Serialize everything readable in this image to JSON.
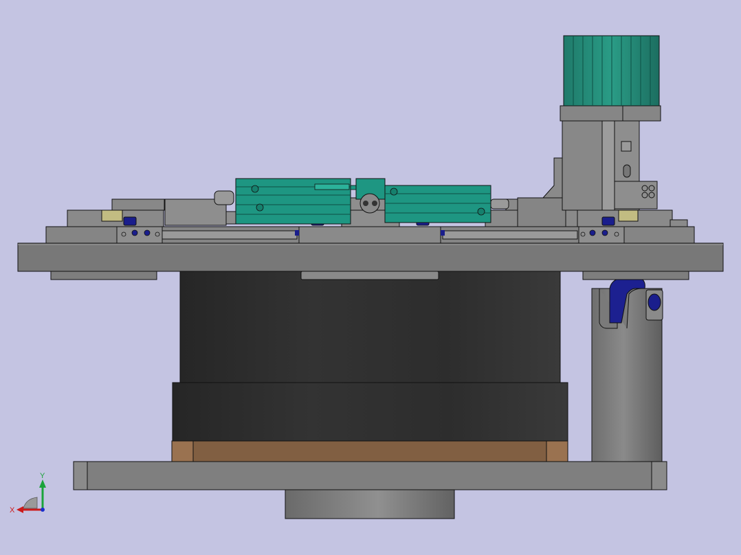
{
  "app": {
    "view": "Front",
    "background_color": "#c4c4e2"
  },
  "colors": {
    "steel": "#7d7d7d",
    "steel_light": "#939393",
    "steel_dark": "#5c5c5c",
    "edge": "#111111",
    "rubber": "#2e2e2e",
    "cylinder_teal": "#1e9682",
    "fastener_blue": "#1a1e8c",
    "wood": "#8a6040",
    "brass": "#b8b27a"
  },
  "triad": {
    "x_label": "X",
    "y_label": "Y",
    "x_color": "#cc1a1a",
    "y_color": "#1aa33a",
    "z_color": "#1a2ecc"
  },
  "parts": [
    {
      "name": "base-plate",
      "icon": "plate-icon"
    },
    {
      "name": "rotary-indexer",
      "icon": "drum-icon"
    },
    {
      "name": "indexer-spacer-ring",
      "icon": "ring-icon"
    },
    {
      "name": "support-column",
      "icon": "column-icon"
    },
    {
      "name": "top-plate",
      "icon": "plate-icon"
    },
    {
      "name": "stepper-motor",
      "icon": "motor-icon"
    },
    {
      "name": "pneumatic-cylinder-left",
      "icon": "cylinder-icon"
    },
    {
      "name": "pneumatic-cylinder-right",
      "icon": "cylinder-icon"
    },
    {
      "name": "slide-blocks",
      "icon": "slide-icon"
    }
  ]
}
